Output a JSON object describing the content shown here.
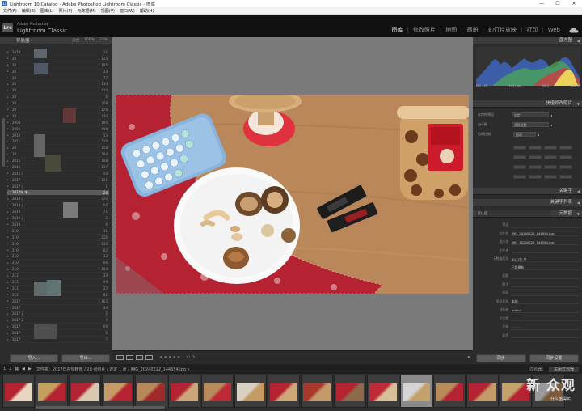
{
  "window": {
    "title": "Lightroom 10 Catalog - Adobe Photoshop Lightroom Classic - 图库",
    "minimize": "—",
    "maximize": "☐",
    "close": "✕"
  },
  "menu": [
    "文件(F)",
    "编辑(E)",
    "图库(L)",
    "照片(P)",
    "元数据(M)",
    "视图(V)",
    "窗口(W)",
    "帮助(H)"
  ],
  "identity": {
    "badge": "Lrc",
    "brand_small": "Adobe Photoshop",
    "brand_big": "Lightroom Classic"
  },
  "modules": [
    {
      "label": "图库",
      "active": true
    },
    {
      "label": "修改照片",
      "active": false
    },
    {
      "label": "地图",
      "active": false
    },
    {
      "label": "画册",
      "active": false
    },
    {
      "label": "幻灯片放映",
      "active": false
    },
    {
      "label": "打印",
      "active": false
    },
    {
      "label": "Web",
      "active": false
    }
  ],
  "left_panel": {
    "navigator_label": "导航器",
    "zoom_options": [
      "适合",
      "100%",
      "33%"
    ],
    "folders": [
      {
        "name": "2019",
        "count": "32"
      },
      {
        "name": "20",
        "count": "125"
      },
      {
        "name": "20",
        "count": "195"
      },
      {
        "name": "20",
        "count": "24"
      },
      {
        "name": "20",
        "count": "77"
      },
      {
        "name": "20",
        "count": "110"
      },
      {
        "name": "20",
        "count": "114"
      },
      {
        "name": "20",
        "count": "6"
      },
      {
        "name": "20",
        "count": "209"
      },
      {
        "name": "20",
        "count": "126"
      },
      {
        "name": "20",
        "count": "120"
      },
      {
        "name": "2008",
        "count": "190"
      },
      {
        "name": "2009",
        "count": "198"
      },
      {
        "name": "2010",
        "count": "53"
      },
      {
        "name": "2011",
        "count": "116"
      },
      {
        "name": "20",
        "count": "158"
      },
      {
        "name": "20",
        "count": "164"
      },
      {
        "name": "2015",
        "count": "108"
      },
      {
        "name": "2016",
        "count": "117"
      },
      {
        "name": "2016 (",
        "count": "56"
      },
      {
        "name": "2017",
        "count": "101"
      },
      {
        "name": "2017 (",
        "count": "1"
      },
      {
        "name": "2017年 中",
        "count": "20",
        "selected": true
      },
      {
        "name": "2018 (",
        "count": "120"
      },
      {
        "name": "2018 (",
        "count": "60"
      },
      {
        "name": "2019",
        "count": "71"
      },
      {
        "name": "2019 (",
        "count": "2"
      },
      {
        "name": "2019",
        "count": "6"
      },
      {
        "name": "210",
        "count": "11"
      },
      {
        "name": "210",
        "count": "126"
      },
      {
        "name": "210",
        "count": "130"
      },
      {
        "name": "210",
        "count": "82"
      },
      {
        "name": "210",
        "count": "12"
      },
      {
        "name": "210",
        "count": "66"
      },
      {
        "name": "210",
        "count": "184"
      },
      {
        "name": "211",
        "count": "20"
      },
      {
        "name": "211",
        "count": "99"
      },
      {
        "name": "211",
        "count": "27"
      },
      {
        "name": "211",
        "count": "81"
      },
      {
        "name": "2017",
        "count": "162"
      },
      {
        "name": "2017",
        "count": "34"
      },
      {
        "name": "2017 2",
        "count": "2"
      },
      {
        "name": "2017 2",
        "count": "4"
      },
      {
        "name": "2017",
        "count": "66"
      },
      {
        "name": "2017",
        "count": "5"
      },
      {
        "name": "2017",
        "count": "7"
      }
    ],
    "import_label": "导入...",
    "export_label": "导出..."
  },
  "toolbar": {
    "stars": "★★★★★",
    "rotate": "↶ ↷",
    "dropdown": "▾"
  },
  "right_panel": {
    "histogram_label": "直方图",
    "histogram_info": [
      "ISO 125",
      "143 mm",
      "f/6.3",
      "1/80 秒"
    ],
    "quick_develop_label": "快速修改照片",
    "quick_develop": [
      {
        "key": "存储的预设",
        "value": "自定",
        "value2": ""
      },
      {
        "key": "白平衡",
        "value": "原照设置",
        "value2": ""
      },
      {
        "key": "色调控制",
        "value": "",
        "value2": "自动"
      }
    ],
    "keywording_label": "关键字",
    "keyword_list_label": "关键字列表",
    "metadata_label": "元数据",
    "metadata_preset": "默认值",
    "metadata": [
      {
        "key": "预设",
        "value": ""
      },
      {
        "key": "文件名",
        "value": "IMG_20240222_144554.jpg"
      },
      {
        "key": "副本名",
        "value": "IMG_20240222_144554.jpg"
      },
      {
        "key": "文件夹",
        "value": ""
      },
      {
        "key": "元数据状态",
        "value": "2017年 中"
      },
      {
        "key": "",
        "value": "已是最新"
      },
      {
        "key": "标题",
        "value": ""
      },
      {
        "key": "题注",
        "value": ""
      },
      {
        "key": "版权",
        "value": ""
      },
      {
        "key": "版权状态",
        "value": "未知"
      },
      {
        "key": "创作者",
        "value": "admin"
      },
      {
        "key": "子位置",
        "value": ""
      },
      {
        "key": "评级",
        "value": "· · · · ·"
      },
      {
        "key": "标签",
        "value": ""
      }
    ],
    "sync_label": "同步",
    "sync_settings_label": "同步设置"
  },
  "filmstrip_header": {
    "page1": "1",
    "page2": "2",
    "path_text": "文件夹：2017年中旬精修 / 20 张照片 / 选定 1 张 / IMG_20240222_144554.jpg ▾",
    "filter_label": "过滤器：",
    "filter_value": "关闭过滤器"
  },
  "filmstrip_count": 17,
  "selected_thumb": 13,
  "watermark": "新 众观",
  "watermark_sub": "什么值得买"
}
